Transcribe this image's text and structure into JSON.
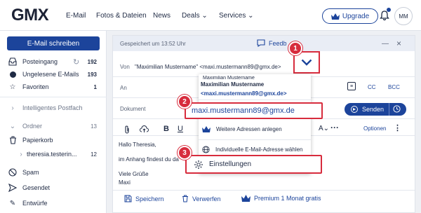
{
  "header": {
    "logo": "GMX",
    "nav": [
      "E-Mail",
      "Fotos & Dateien",
      "News",
      "Deals",
      "Services"
    ],
    "upgrade_label": "Upgrade",
    "avatar_initials": "MM"
  },
  "sidebar": {
    "compose_label": "E-Mail schreiben",
    "items": [
      {
        "label": "Posteingang",
        "count": "192"
      },
      {
        "label": "Ungelesene E-Mails",
        "count": "193"
      },
      {
        "label": "Favoriten",
        "count": "1"
      },
      {
        "label": "Intelligentes Postfach",
        "count": ""
      },
      {
        "label": "Ordner",
        "count": "13"
      },
      {
        "label": "Papierkorb",
        "count": ""
      },
      {
        "label": "theresia.testerin...",
        "count": "12"
      },
      {
        "label": "Spam",
        "count": ""
      },
      {
        "label": "Gesendet",
        "count": ""
      },
      {
        "label": "Entwürfe",
        "count": ""
      }
    ]
  },
  "compose": {
    "saved_text": "Gespeichert um 13:52 Uhr",
    "feedback_label": "Feedb",
    "from_label": "Von",
    "from_value": "\"Maximilian Mustername\" <maxi.mustermann89@gmx.de>",
    "to_label": "An",
    "cc_label": "CC",
    "bcc_label": "BCC",
    "subject_label": "Dokument",
    "send_label": "Senden",
    "options_label": "Optionen",
    "body_lines": [
      "Hallo Theresia,",
      "im Anhang findest du da",
      "Viele Grüße",
      "Maxi"
    ],
    "actions": [
      "Speichern",
      "Verwerfen",
      "Premium 1 Monat gratis"
    ]
  },
  "dropdown": {
    "header_partial": "Maximilian Mustername",
    "name": "Maximilian Mustername",
    "email": "<maxi.mustermann89@gmx.de>",
    "selected_email": "maxi.mustermann89@gmx.de",
    "items": [
      "Weitere Adressen anlegen",
      "Individuelle E-Mail-Adresse wählen",
      "Einstellungen"
    ]
  },
  "badges": [
    "1",
    "2",
    "3"
  ],
  "colors": {
    "brand": "#1c449b",
    "highlight": "#d72c3d"
  }
}
